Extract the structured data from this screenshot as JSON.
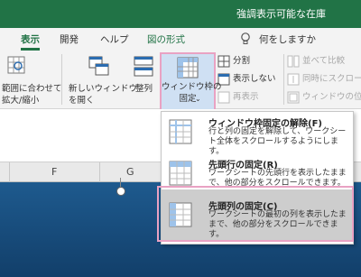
{
  "titlebar": {
    "title": "強調表示可能な在庫"
  },
  "tabs": [
    {
      "label": "表示",
      "active": true
    },
    {
      "label": "開発"
    },
    {
      "label": "ヘルプ"
    },
    {
      "label": "図の形式",
      "green": true
    },
    {
      "label": "何をしますか"
    }
  ],
  "ribbon": {
    "zoom_to_selection": "範囲に合わせて\n拡大/縮小",
    "new_window": "新しいウィンドウ\nを開く",
    "arrange": "整列",
    "freeze_panes": "ウィンドウ枠の\n固定",
    "split": "分割",
    "hide": "表示しない",
    "unhide": "再表示",
    "side_by_side": "並べて比較",
    "sync_scroll": "同時にスクロール",
    "reset_position": "ウィンドウの位置"
  },
  "columns": [
    "F",
    "G"
  ],
  "menu": {
    "items": [
      {
        "title": "ウィンドウ枠固定の解除(F)",
        "desc": "行と列の固定を解除して、ワークシート全体をスクロールするようにします。"
      },
      {
        "title": "先頭行の固定(R)",
        "desc": "ワークシートの先頭行を表示したままで、他の部分をスクロールできます。"
      },
      {
        "title": "先頭列の固定(C)",
        "desc": "ワークシートの最初の列を表示したままで、他の部分をスクロールできます。",
        "highlighted": true
      }
    ]
  },
  "colors": {
    "brand": "#217346",
    "highlight_border": "#e9a2c3",
    "menu_highlight": "#cdcdcd"
  }
}
